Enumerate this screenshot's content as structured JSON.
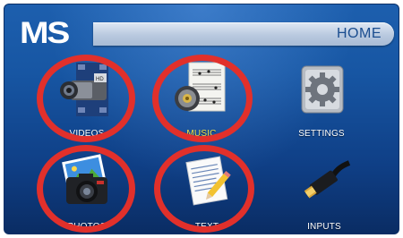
{
  "header": {
    "logo_text": "MS",
    "title": "HOME"
  },
  "menu": {
    "videos": {
      "label": "VIDEOS"
    },
    "music": {
      "label": "MUSIC",
      "selected": true
    },
    "settings": {
      "label": "SETTINGS"
    },
    "photos": {
      "label": "PHOTOS"
    },
    "text": {
      "label": "TEXT"
    },
    "inputs": {
      "label": "INPUTS"
    }
  },
  "colors": {
    "background": "#1756a3",
    "selected_label": "#f3e44a",
    "annotation_ring": "#e1302b"
  },
  "icons": {
    "videos": "camcorder-icon",
    "music": "speaker-music-sheet-icon",
    "settings": "gear-icon",
    "photos": "camera-photo-icon",
    "text": "document-pen-icon",
    "inputs": "hdmi-cable-icon"
  }
}
